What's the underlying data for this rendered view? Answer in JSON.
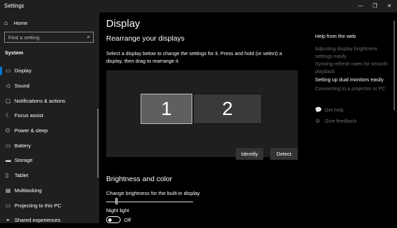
{
  "window": {
    "title": "Settings",
    "minimize_glyph": "—",
    "restore_glyph": "❐",
    "close_glyph": "✕"
  },
  "sidebar": {
    "home_icon": "home-icon",
    "home_label": "Home",
    "search_placeholder": "Find a setting",
    "search_icon": "search-icon",
    "section_title": "System",
    "items": [
      {
        "label": "Display",
        "icon": "monitor-icon",
        "glyph": "▭",
        "active": true
      },
      {
        "label": "Sound",
        "icon": "speaker-icon",
        "glyph": "◁",
        "active": false
      },
      {
        "label": "Notifications & actions",
        "icon": "notification-icon",
        "glyph": "▢",
        "active": false
      },
      {
        "label": "Focus assist",
        "icon": "moon-icon",
        "glyph": "☾",
        "active": false
      },
      {
        "label": "Power & sleep",
        "icon": "power-icon",
        "glyph": "⏻",
        "active": false
      },
      {
        "label": "Battery",
        "icon": "battery-icon",
        "glyph": "▭",
        "active": false
      },
      {
        "label": "Storage",
        "icon": "storage-icon",
        "glyph": "▬",
        "active": false
      },
      {
        "label": "Tablet",
        "icon": "tablet-icon",
        "glyph": "▯",
        "active": false
      },
      {
        "label": "Multitasking",
        "icon": "multitasking-icon",
        "glyph": "▤",
        "active": false
      },
      {
        "label": "Projecting to this PC",
        "icon": "projecting-icon",
        "glyph": "▭",
        "active": false
      },
      {
        "label": "Shared experiences",
        "icon": "shared-icon",
        "glyph": "⚭",
        "active": false
      }
    ]
  },
  "main": {
    "title": "Display",
    "rearrange_heading": "Rearrange your displays",
    "rearrange_desc": "Select a display below to change the settings for it. Press and hold (or select) a display, then drag to rearrange it.",
    "displays": [
      "1",
      "2"
    ],
    "identify_label": "Identify",
    "detect_label": "Detect",
    "brightness_heading": "Brightness and color",
    "brightness_label": "Change brightness for the built-in display",
    "brightness_value": 0.1,
    "night_light_label": "Night light",
    "night_light_state": "Off"
  },
  "help": {
    "title": "Help from the web",
    "links": [
      {
        "text": "Adjusting display brightness settings easily",
        "active": false
      },
      {
        "text": "Syncing refresh rates for smooth playback",
        "active": false
      },
      {
        "text": "Setting up dual monitors easily",
        "active": true
      },
      {
        "text": "Connecting to a projector or PC",
        "active": false
      }
    ],
    "get_help": "Get help",
    "give_feedback": "Give feedback"
  },
  "colors": {
    "accent": "#0078d7",
    "sidebar_bg": "#1f1f1f",
    "selected_display": "#5f5f5f",
    "other_display": "#3a3a3a"
  }
}
